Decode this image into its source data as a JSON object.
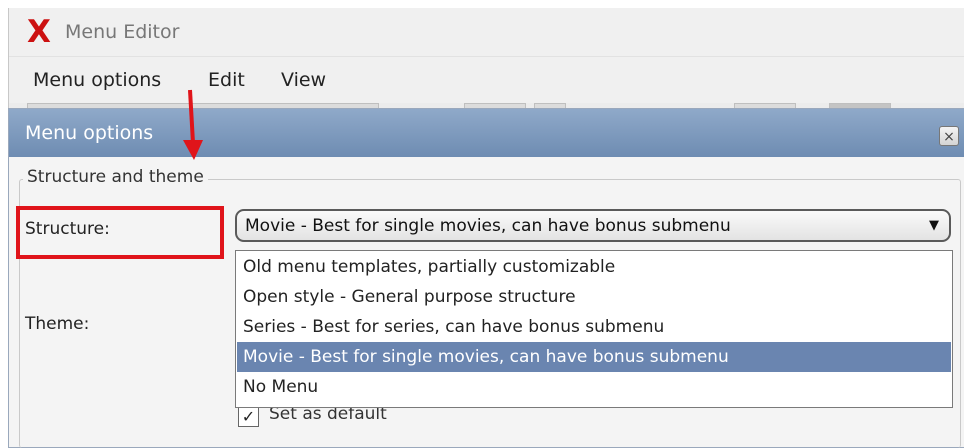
{
  "window": {
    "logo": "X",
    "title": "Menu Editor"
  },
  "menu_bar": {
    "items": [
      {
        "label": "Menu options"
      },
      {
        "label": "Edit"
      },
      {
        "label": "View"
      }
    ]
  },
  "dialog": {
    "title": "Menu options",
    "close_symbol": "×",
    "group_title": "Structure and theme",
    "structure_label": "Structure:",
    "theme_label": "Theme:",
    "structure_select": {
      "value": "Movie - Best for single movies, can have bonus submenu",
      "arrow": "▼",
      "options": [
        {
          "label": "Old menu templates, partially customizable",
          "selected": false
        },
        {
          "label": "Open style - General purpose structure",
          "selected": false
        },
        {
          "label": "Series - Best for series, can have bonus submenu",
          "selected": false
        },
        {
          "label": "Movie - Best for single movies, can have bonus submenu",
          "selected": true
        },
        {
          "label": "No Menu",
          "selected": false
        }
      ]
    },
    "default_checkbox": {
      "label": "Set as default",
      "checked": true,
      "check_mark": "✓"
    }
  },
  "annotations": {
    "highlight_color": "#e0141a",
    "arrow_color": "#e0141a"
  },
  "colors": {
    "dialog_title_bar": "#7b97bd",
    "selected_option": "#6a85b0",
    "logo": "#cc1111"
  }
}
